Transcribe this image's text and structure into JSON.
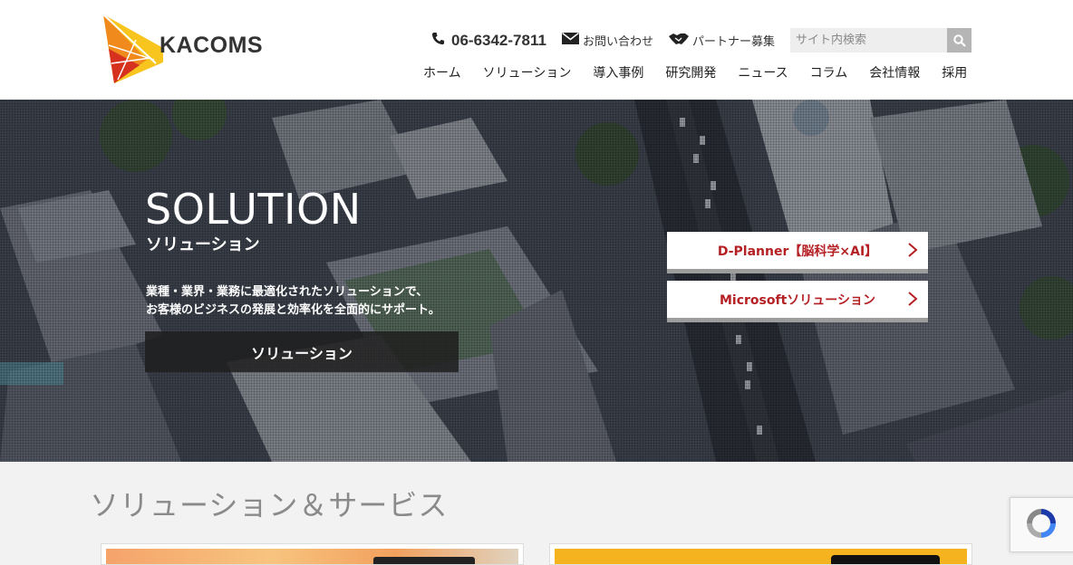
{
  "header": {
    "logo_text": "KACOMS",
    "phone": "06-6342-7811",
    "contact_label": "お問い合わせ",
    "partner_label": "パートナー募集",
    "search_placeholder": "サイト内検索",
    "nav": [
      "ホーム",
      "ソリューション",
      "導入事例",
      "研究開発",
      "ニュース",
      "コラム",
      "会社情報",
      "採用"
    ]
  },
  "hero": {
    "title": "SOLUTION",
    "subtitle": "ソリューション",
    "desc_line1": "業種・業界・業務に最適化されたソリューションで、",
    "desc_line2": "お客様のビジネスの発展と効率化を全面的にサポート。",
    "button_label": "ソリューション",
    "cards": [
      "D-Planner【脳科学×AI】",
      "Microsoftソリューション"
    ]
  },
  "section": {
    "title": "ソリューション＆サービス"
  },
  "colors": {
    "accent_red": "#b52024",
    "logo_orange": "#f08a1c",
    "logo_yellow": "#f7c51e",
    "logo_red": "#d6301f"
  },
  "icons": [
    "phone-icon",
    "mail-icon",
    "handshake-icon",
    "search-icon",
    "chevron-right-icon"
  ]
}
